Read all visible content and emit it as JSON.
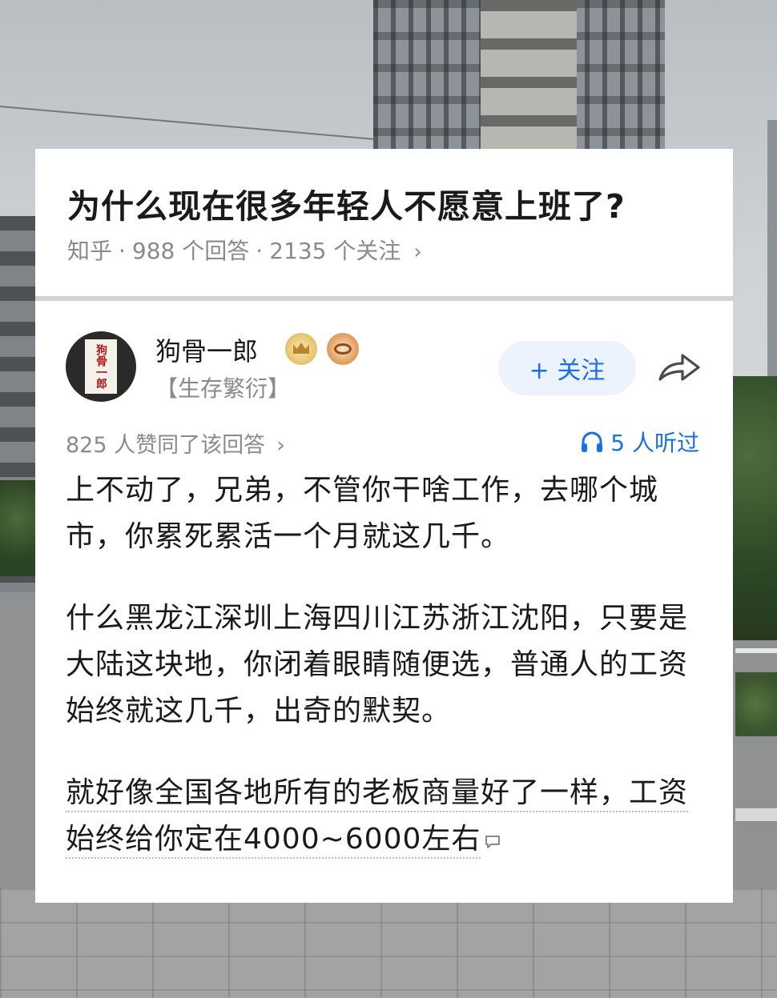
{
  "question": {
    "title": "为什么现在很多年轻人不愿意上班了?",
    "source": "知乎",
    "separator": "·",
    "answers": "988 个回答",
    "followers": "2135 个关注",
    "chevron": "›"
  },
  "author": {
    "name": "狗骨一郎",
    "title": "【生存繁衍】",
    "avatar_text": "狗骨一郎",
    "badges": [
      "crown-badge-icon",
      "eye-badge-icon"
    ]
  },
  "actions": {
    "follow_label": "+ 关注",
    "share_icon": "share-arrow-icon"
  },
  "stats": {
    "votes": "825 人赞同了该回答",
    "chevron": "›",
    "listeners": "5 人听过",
    "listen_icon": "headphones-icon"
  },
  "answer": {
    "paragraphs": [
      "上不动了，兄弟，不管你干啥工作，去哪个城市，你累死累活一个月就这几千。",
      "什么黑龙江深圳上海四川江苏浙江沈阳，只要是大陆这块地，你闭着眼睛随便选，普通人的工资始终就这几千，出奇的默契。",
      "就好像全国各地所有的老板商量好了一样，工资始终给你定在4000~6000左右"
    ],
    "comment_icon": "comment-bubble-icon"
  },
  "colors": {
    "accent": "#1a6fe6",
    "follow_bg": "#edf3fe",
    "meta_text": "#8a8a8e",
    "body_text": "#1a1a1a"
  }
}
